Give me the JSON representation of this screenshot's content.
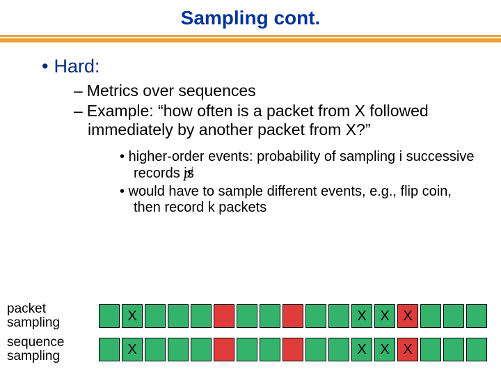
{
  "title": "Sampling cont.",
  "bullets": {
    "l1": "Hard:",
    "l2a": "Metrics over sequences",
    "l2b": "Example: “how often is a packet from X followed immediately by another packet from X?”",
    "l3a_pre": "higher-order events: probability of sampling i successive records is ",
    "l3a_sym": "p",
    "l3a_sup": "i",
    "l3b": "would have to sample different events, e.g., flip coin, then record k packets"
  },
  "rows": [
    {
      "label": "packet\nsampling",
      "cells": [
        {
          "c": "g",
          "t": ""
        },
        {
          "c": "g",
          "t": "X"
        },
        {
          "c": "g",
          "t": ""
        },
        {
          "c": "g",
          "t": ""
        },
        {
          "c": "g",
          "t": ""
        },
        {
          "c": "r",
          "t": ""
        },
        {
          "c": "g",
          "t": ""
        },
        {
          "c": "g",
          "t": ""
        },
        {
          "c": "r",
          "t": ""
        },
        {
          "c": "g",
          "t": ""
        },
        {
          "c": "g",
          "t": ""
        },
        {
          "c": "g",
          "t": "X"
        },
        {
          "c": "g",
          "t": "X"
        },
        {
          "c": "r",
          "t": "X"
        },
        {
          "c": "g",
          "t": ""
        },
        {
          "c": "g",
          "t": ""
        },
        {
          "c": "g",
          "t": ""
        }
      ]
    },
    {
      "label": "sequence\nsampling",
      "cells": [
        {
          "c": "g",
          "t": ""
        },
        {
          "c": "g",
          "t": "X"
        },
        {
          "c": "g",
          "t": ""
        },
        {
          "c": "g",
          "t": ""
        },
        {
          "c": "g",
          "t": ""
        },
        {
          "c": "r",
          "t": ""
        },
        {
          "c": "g",
          "t": ""
        },
        {
          "c": "g",
          "t": ""
        },
        {
          "c": "r",
          "t": ""
        },
        {
          "c": "g",
          "t": ""
        },
        {
          "c": "g",
          "t": ""
        },
        {
          "c": "g",
          "t": "X"
        },
        {
          "c": "g",
          "t": "X"
        },
        {
          "c": "r",
          "t": "X"
        },
        {
          "c": "g",
          "t": ""
        },
        {
          "c": "g",
          "t": ""
        },
        {
          "c": "g",
          "t": ""
        }
      ]
    }
  ]
}
